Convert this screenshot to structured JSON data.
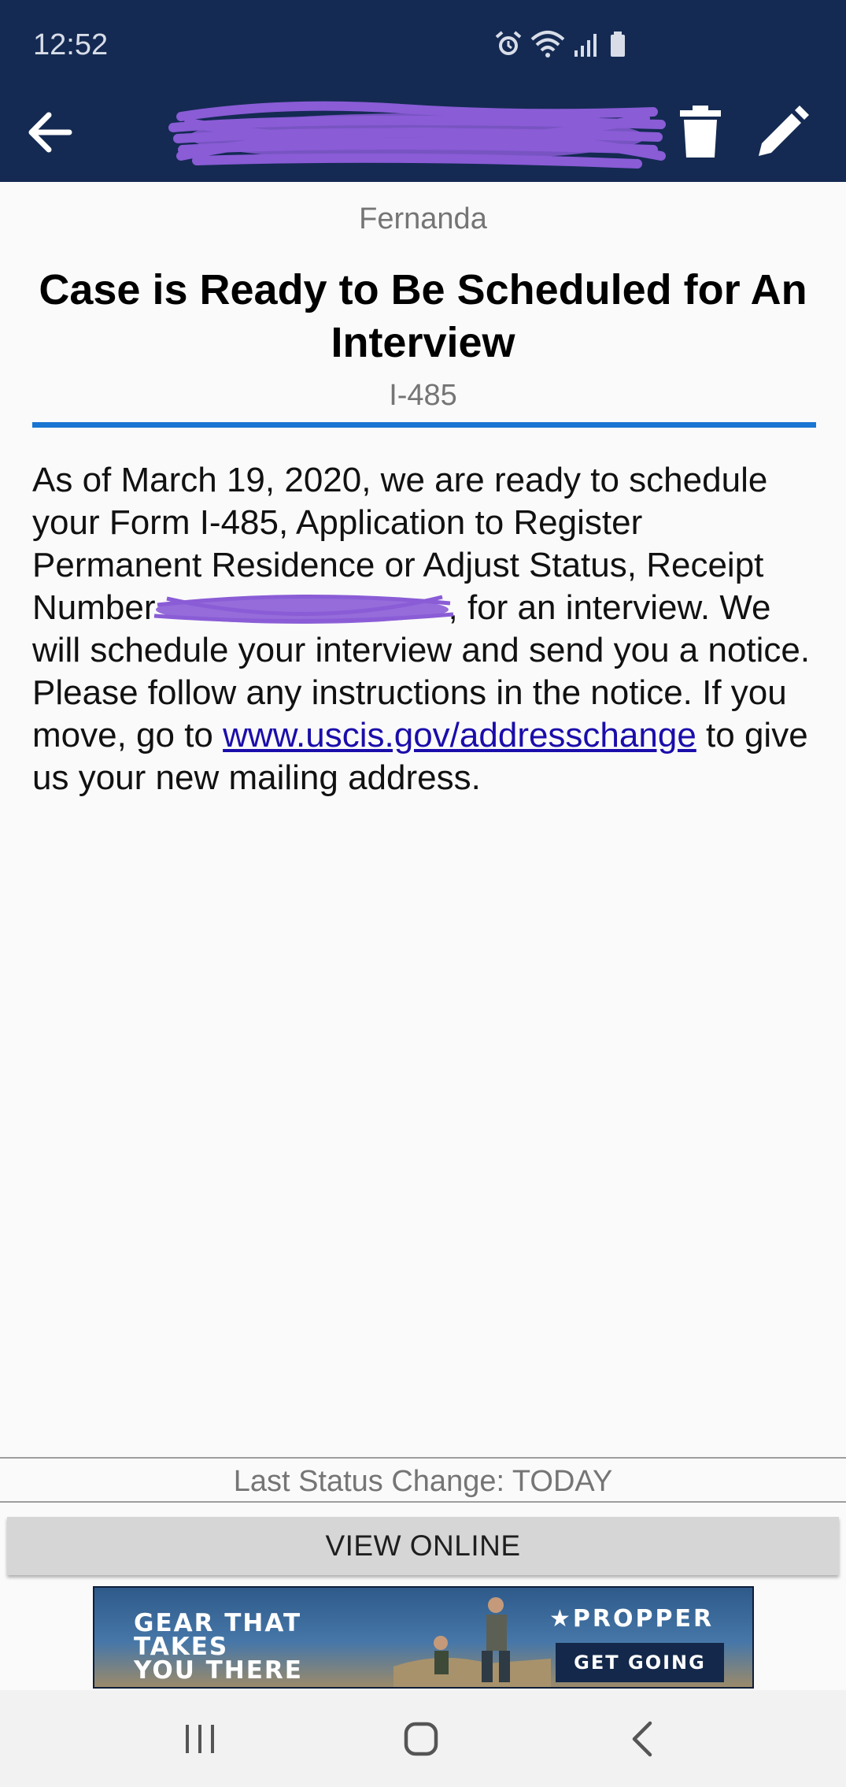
{
  "status_bar": {
    "time": "12:52",
    "icons": [
      "alarm-icon",
      "wifi-icon",
      "signal-icon",
      "battery-icon"
    ]
  },
  "app_bar": {
    "icons": [
      "back-arrow-icon",
      "trash-icon",
      "pencil-icon"
    ],
    "background": "#142a52"
  },
  "case": {
    "sender": "Fernanda",
    "title": "Case is Ready to Be Scheduled for An Interview",
    "form_type": "I-485",
    "body_before": "As of March 19, 2020, we are ready to schedule your Form I-485, Application to Register Permanent Residence or Adjust Status, Receipt Number",
    "body_middle": ", for an interview. We will schedule your interview and send you a notice. Please follow any instructions in the notice. If you move, go to ",
    "link_text": "www.uscis.gov/addresschange",
    "body_after": " to give us your new mailing address.",
    "accent_color": "#1976d2"
  },
  "footer": {
    "last_status": "Last Status Change: TODAY",
    "view_online_label": "VIEW ONLINE"
  },
  "ad": {
    "headline": "GEAR THAT TAKES\nYOU THERE",
    "brand": "★PROPPER",
    "cta": "GET GOING"
  },
  "nav_bar": {
    "icons": [
      "recents-icon",
      "home-icon",
      "back-icon"
    ]
  }
}
